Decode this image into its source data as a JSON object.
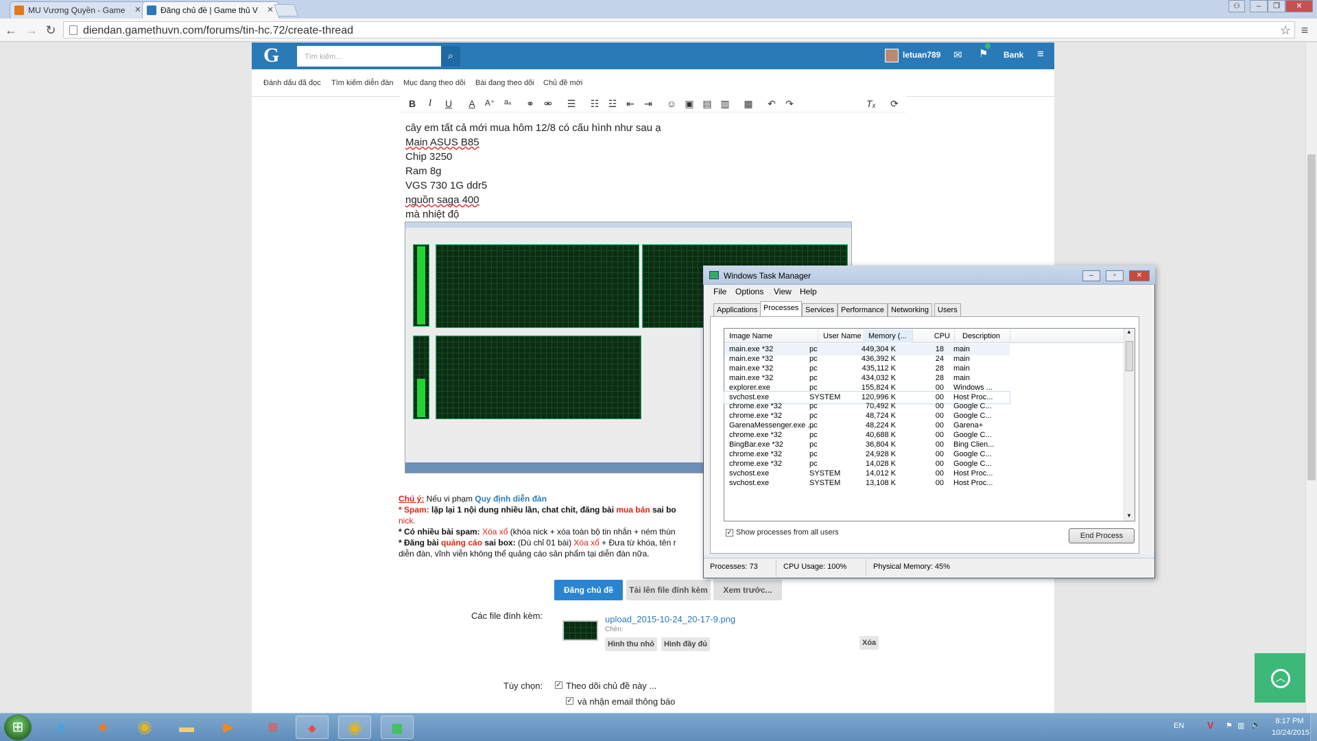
{
  "browser": {
    "tabs": [
      {
        "title": "MU Vương Quyền - Game"
      },
      {
        "title": "Đăng chủ đề | Game thủ V"
      }
    ],
    "url": "diendan.gamethuvn.com/forums/tin-hc.72/create-thread"
  },
  "site": {
    "logo": "G",
    "search_placeholder": "Tìm kiếm...",
    "username": "letuan789",
    "bank_label": "Bank",
    "subnav": [
      "Đánh dấu đã đọc",
      "Tìm kiếm diễn đàn",
      "Mục đang theo dõi",
      "Bài đang theo dõi",
      "Chủ đề mới"
    ]
  },
  "editor": {
    "lines": [
      "cây em tất cả mới mua hôm 12/8 có cấu hình như sau ạ",
      "Main ASUS B85",
      "Chip 3250",
      "Ram 8g",
      "VGS 730 1G ddr5",
      "nguồn saga 400",
      " mà nhiệt độ"
    ]
  },
  "notice": {
    "chuy": "Chú ý:",
    "chuy_text": " Nếu vi phạm ",
    "rules_link": "Quy định diễn đàn",
    "spam_label": "* Spam:",
    "spam_text": " lặp lại 1 nội dung nhiều lần, chat chit, đăng bài ",
    "spam_red": "mua bán",
    "spam_tail": " sai bo",
    "nick": "nick.",
    "many_label": "* Có nhiều bài spam:",
    "xoa_xo": " Xóa xổ",
    "many_text": " (khóa nick + xóa toàn bộ tin nhắn + ném thùn",
    "ads_label": "* Đăng bài",
    "ads_red": " quảng cáo",
    "ads_label2": " sai box:",
    "ads_text": " (Dù chỉ 01 bài) ",
    "ads_xoa": "Xóa xổ",
    "ads_tail": " + Đưa từ khóa, tên r",
    "ads_line2": "diễn đàn, vĩnh viễn không thể quảng cáo sản phẩm tại diễn đàn nữa."
  },
  "buttons": {
    "post": "Đăng chủ đề",
    "upload": "Tải lên file đính kèm",
    "preview": "Xem trước..."
  },
  "attachments": {
    "label": "Các file đính kèm:",
    "filename": "upload_2015-10-24_20-17-9.png",
    "insert_label": "Chèn:",
    "thumb_btn": "Hình thu nhỏ",
    "full_btn": "Hình đầy đủ",
    "delete_btn": "Xóa"
  },
  "options": {
    "label": "Tùy chọn:",
    "watch": "Theo dõi chủ đề này ...",
    "email": "và nhận email thông báo"
  },
  "taskmanager": {
    "title": "Windows Task Manager",
    "menu": [
      "File",
      "Options",
      "View",
      "Help"
    ],
    "tabs": [
      "Applications",
      "Processes",
      "Services",
      "Performance",
      "Networking",
      "Users"
    ],
    "active_tab": "Processes",
    "columns": [
      "Image Name",
      "User Name",
      "Memory (...",
      "CPU",
      "Description"
    ],
    "rows": [
      [
        "main.exe *32",
        "pc",
        "449,304 K",
        "18",
        "main"
      ],
      [
        "main.exe *32",
        "pc",
        "436,392 K",
        "24",
        "main"
      ],
      [
        "main.exe *32",
        "pc",
        "435,112 K",
        "28",
        "main"
      ],
      [
        "main.exe *32",
        "pc",
        "434,032 K",
        "28",
        "main"
      ],
      [
        "explorer.exe",
        "pc",
        "155,824 K",
        "00",
        "Windows ..."
      ],
      [
        "svchost.exe",
        "SYSTEM",
        "120,996 K",
        "00",
        "Host Proc..."
      ],
      [
        "chrome.exe *32",
        "pc",
        "70,492 K",
        "00",
        "Google C..."
      ],
      [
        "chrome.exe *32",
        "pc",
        "48,724 K",
        "00",
        "Google C..."
      ],
      [
        "GarenaMessenger.exe ...",
        "pc",
        "48,224 K",
        "00",
        "Garena+"
      ],
      [
        "chrome.exe *32",
        "pc",
        "40,688 K",
        "00",
        "Google C..."
      ],
      [
        "BingBar.exe *32",
        "pc",
        "36,804 K",
        "00",
        "Bing Clien..."
      ],
      [
        "chrome.exe *32",
        "pc",
        "24,928 K",
        "00",
        "Google C..."
      ],
      [
        "chrome.exe *32",
        "pc",
        "14,028 K",
        "00",
        "Google C..."
      ],
      [
        "svchost.exe",
        "SYSTEM",
        "14,012 K",
        "00",
        "Host Proc..."
      ],
      [
        "svchost.exe",
        "SYSTEM",
        "13,108 K",
        "00",
        "Host Proc..."
      ]
    ],
    "show_all": "Show processes from all users",
    "end_process": "End Process",
    "status": {
      "processes": "Processes: 73",
      "cpu": "CPU Usage: 100%",
      "memory": "Physical Memory: 45%"
    }
  },
  "taskbar": {
    "lang": "EN",
    "time": "8:17 PM",
    "date": "10/24/2015"
  }
}
